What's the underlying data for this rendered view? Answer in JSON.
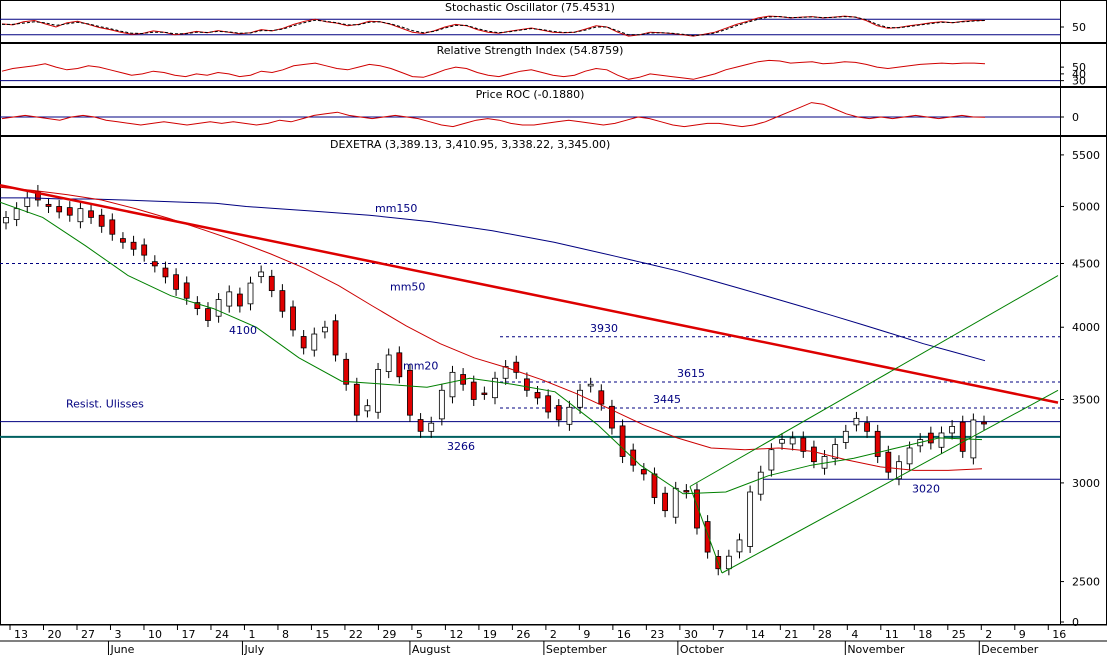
{
  "chart_data": [
    {
      "type": "line",
      "title": "Stochastic Oscillator (75.4531)",
      "yticks": [
        {
          "value": 50,
          "label": "50"
        }
      ],
      "ylim": [
        0,
        100
      ],
      "levels": [
        20,
        80
      ],
      "series": [
        {
          "color": "#d00000",
          "values": [
            62,
            58,
            70,
            75,
            62,
            50,
            66,
            72,
            60,
            48,
            40,
            30,
            22,
            25,
            35,
            30,
            20,
            25,
            33,
            28,
            36,
            30,
            24,
            28,
            40,
            35,
            45,
            60,
            72,
            80,
            70,
            65,
            55,
            60,
            72,
            70,
            60,
            45,
            30,
            25,
            35,
            50,
            60,
            55,
            40,
            30,
            26,
            34,
            40,
            46,
            38,
            30,
            28,
            30,
            42,
            55,
            50,
            30,
            15,
            20,
            30,
            28,
            25,
            20,
            15,
            22,
            30,
            45,
            60,
            72,
            85,
            92,
            90,
            85,
            88,
            90,
            85,
            88,
            92,
            88,
            75,
            55,
            45,
            48,
            55,
            60,
            66,
            70,
            66,
            72,
            75,
            75
          ]
        },
        {
          "color": "#000000",
          "dashed": true,
          "values": [
            60,
            60,
            65,
            70,
            66,
            56,
            62,
            68,
            62,
            52,
            44,
            34,
            26,
            25,
            30,
            30,
            24,
            24,
            30,
            29,
            33,
            31,
            26,
            27,
            36,
            36,
            42,
            55,
            67,
            76,
            72,
            66,
            58,
            59,
            68,
            70,
            62,
            50,
            36,
            28,
            33,
            46,
            56,
            56,
            44,
            34,
            28,
            32,
            38,
            44,
            40,
            33,
            29,
            30,
            38,
            50,
            50,
            35,
            20,
            20,
            27,
            28,
            26,
            22,
            17,
            20,
            27,
            40,
            55,
            68,
            80,
            89,
            90,
            86,
            87,
            89,
            86,
            87,
            90,
            88,
            78,
            60,
            48,
            47,
            52,
            58,
            63,
            68,
            67,
            70,
            73,
            75
          ]
        }
      ]
    },
    {
      "type": "line",
      "title": "Relative Strength Index (54.8759)",
      "yticks": [
        {
          "value": 50,
          "label": "50"
        },
        {
          "value": 40,
          "label": "40"
        },
        {
          "value": 30,
          "label": "30"
        }
      ],
      "ylim": [
        25,
        65
      ],
      "levels": [
        30
      ],
      "series": [
        {
          "color": "#d00000",
          "values": [
            44,
            48,
            50,
            52,
            55,
            50,
            46,
            48,
            52,
            50,
            46,
            42,
            38,
            40,
            44,
            42,
            38,
            36,
            40,
            38,
            42,
            40,
            36,
            38,
            44,
            42,
            46,
            52,
            54,
            56,
            52,
            48,
            46,
            50,
            54,
            52,
            48,
            42,
            36,
            35,
            40,
            46,
            50,
            48,
            42,
            38,
            36,
            40,
            44,
            46,
            42,
            38,
            36,
            38,
            44,
            48,
            46,
            38,
            32,
            35,
            40,
            38,
            36,
            34,
            32,
            36,
            40,
            46,
            50,
            54,
            58,
            60,
            59,
            56,
            57,
            58,
            55,
            56,
            58,
            57,
            54,
            50,
            48,
            50,
            52,
            54,
            55,
            56,
            55,
            56,
            56,
            55
          ]
        }
      ]
    },
    {
      "type": "line",
      "title": "Price ROC (-0.1880)",
      "yticks": [
        {
          "value": 0,
          "label": "0"
        }
      ],
      "ylim": [
        -10,
        10
      ],
      "levels": [
        0
      ],
      "series": [
        {
          "color": "#d00000",
          "values": [
            -1,
            0,
            1,
            0,
            -1,
            -2,
            0,
            1,
            0,
            -2,
            -3,
            -4,
            -5,
            -4,
            -3,
            -4,
            -5,
            -4,
            -3,
            -4,
            -3,
            -4,
            -5,
            -4,
            -2,
            -3,
            -1,
            1,
            2,
            3,
            1,
            0,
            -1,
            0,
            1,
            0,
            -1,
            -3,
            -5,
            -6,
            -4,
            -2,
            -1,
            -2,
            -4,
            -5,
            -5,
            -4,
            -3,
            -2,
            -3,
            -4,
            -5,
            -4,
            -2,
            0,
            -1,
            -3,
            -5,
            -6,
            -5,
            -4,
            -4,
            -5,
            -6,
            -5,
            -3,
            0,
            3,
            6,
            9,
            8,
            5,
            2,
            0,
            -1,
            0,
            -1,
            0,
            1,
            0,
            -1,
            0,
            1,
            0,
            -0.2
          ]
        }
      ]
    },
    {
      "type": "candlestick",
      "title": "DEXETRA (3,389.13, 3,410.95, 3,338.22, 3,345.00)",
      "scale": "log",
      "ylim": [
        2320,
        5550
      ],
      "yticks": [
        {
          "value": 5500,
          "label": "5500"
        },
        {
          "value": 5000,
          "label": "5000"
        },
        {
          "value": 4500,
          "label": "4500"
        },
        {
          "value": 4000,
          "label": "4000"
        },
        {
          "value": 3500,
          "label": "3500"
        },
        {
          "value": 3000,
          "label": "3000"
        },
        {
          "value": 2500,
          "label": "2500"
        },
        {
          "value": 2320,
          "label": "0"
        }
      ],
      "x_dates": [
        "May 13",
        "May 20",
        "May 27",
        "Jun 3",
        "Jun 10",
        "Jun 17",
        "Jun 24",
        "Jul 1",
        "Jul 8",
        "Jul 15",
        "Jul 22",
        "Jul 29",
        "Aug 5",
        "Aug 12",
        "Aug 19",
        "Aug 26",
        "Sep 2",
        "Sep 9",
        "Sep 16",
        "Sep 23",
        "Sep 30",
        "Oct 7",
        "Oct 14",
        "Oct 21",
        "Oct 28",
        "Nov 4",
        "Nov 11",
        "Nov 18",
        "Nov 25",
        "Dec 2",
        "Dec 9",
        "Dec 16"
      ],
      "x_tick_labels": [
        "13",
        "20",
        "27",
        "3",
        "10",
        "17",
        "24",
        "1",
        "8",
        "15",
        "22",
        "29",
        "5",
        "12",
        "19",
        "26",
        "2",
        "9",
        "16",
        "23",
        "30",
        "7",
        "14",
        "21",
        "28",
        "4",
        "11",
        "18",
        "25",
        "2",
        "9",
        "16"
      ],
      "month_labels": [
        {
          "label": "June",
          "at": 3
        },
        {
          "label": "July",
          "at": 7
        },
        {
          "label": "August",
          "at": 12
        },
        {
          "label": "September",
          "at": 16
        },
        {
          "label": "October",
          "at": 20
        },
        {
          "label": "November",
          "at": 25
        },
        {
          "label": "December",
          "at": 29
        }
      ],
      "closes": [
        4900,
        4980,
        5080,
        5060,
        5000,
        4950,
        4920,
        4980,
        4900,
        4820,
        4750,
        4680,
        4620,
        4570,
        4480,
        4390,
        4290,
        4220,
        4140,
        4050,
        4210,
        4270,
        4160,
        4340,
        4430,
        4280,
        4120,
        3980,
        3850,
        3950,
        4000,
        3800,
        3600,
        3400,
        3460,
        3700,
        3800,
        3650,
        3400,
        3300,
        3350,
        3560,
        3680,
        3600,
        3500,
        3540,
        3640,
        3720,
        3680,
        3560,
        3510,
        3420,
        3370,
        3450,
        3560,
        3600,
        3470,
        3320,
        3150,
        3100,
        3050,
        2920,
        2850,
        2970,
        2950,
        2760,
        2640,
        2560,
        2620,
        2700,
        2950,
        3060,
        3190,
        3250,
        3260,
        3180,
        3120,
        3150,
        3220,
        3300,
        3380,
        3300,
        3150,
        3060,
        3120,
        3200,
        3250,
        3230,
        3290,
        3330,
        3180,
        3370,
        3345
      ],
      "candle_colors": {
        "up": "#ffffff",
        "down": "#e00000"
      },
      "overlays": [
        {
          "name": "mm150",
          "color": "#000080",
          "values": [
            5080,
            5080,
            5070,
            5070,
            5060,
            5050,
            5040,
            5030,
            5000,
            4980,
            4960,
            4940,
            4920,
            4890,
            4860,
            4820,
            4780,
            4730,
            4680,
            4620,
            4560,
            4500,
            4440,
            4370,
            4300,
            4230,
            4160,
            4090,
            4020,
            3950,
            3880,
            3820,
            3760
          ]
        },
        {
          "name": "mm50",
          "color": "#cc0000",
          "values": [
            5180,
            5150,
            5110,
            5060,
            4980,
            4890,
            4790,
            4690,
            4580,
            4460,
            4320,
            4160,
            4010,
            3880,
            3780,
            3710,
            3630,
            3540,
            3440,
            3340,
            3260,
            3200,
            3190,
            3200,
            3180,
            3130,
            3090,
            3070,
            3070,
            3080
          ]
        },
        {
          "name": "mm20",
          "color": "#008000",
          "values": [
            5040,
            4900,
            4650,
            4400,
            4240,
            4140,
            4000,
            3780,
            3620,
            3600,
            3580,
            3640,
            3600,
            3550,
            3340,
            3100,
            2940,
            2950,
            3040,
            3100,
            3140,
            3200,
            3260,
            3250
          ]
        },
        {
          "name": "red-trend",
          "color": "#dd0000",
          "values": [
            5200,
            3480
          ]
        },
        {
          "name": "green-up-upper",
          "color": "#008000",
          "values": [
            2980,
            4400
          ]
        },
        {
          "name": "green-up-lower",
          "color": "#008000",
          "values": [
            2540,
            3560
          ]
        }
      ],
      "horizontal_levels": [
        {
          "value": 4500,
          "style": "dashed",
          "color": "#000080"
        },
        {
          "value": 3930,
          "style": "dashed",
          "color": "#000080",
          "label": "3930"
        },
        {
          "value": 3615,
          "style": "dashed",
          "color": "#000080",
          "label": "3615"
        },
        {
          "value": 3445,
          "style": "dashed",
          "color": "#000080",
          "label": "3445"
        },
        {
          "value": 3360,
          "style": "solid",
          "color": "#000080"
        },
        {
          "value": 3266,
          "style": "solid",
          "color": "#006060",
          "label": "3266"
        },
        {
          "value": 3020,
          "style": "solid",
          "color": "#000080",
          "label": "3020"
        }
      ],
      "annotations": [
        {
          "text": "mm150",
          "color": "#000080"
        },
        {
          "text": "mm50",
          "color": "#000080"
        },
        {
          "text": "mm20",
          "color": "#000080"
        },
        {
          "text": "4100",
          "color": "#000080"
        },
        {
          "text": "Resist. Ulisses",
          "color": "#000080"
        }
      ]
    }
  ]
}
